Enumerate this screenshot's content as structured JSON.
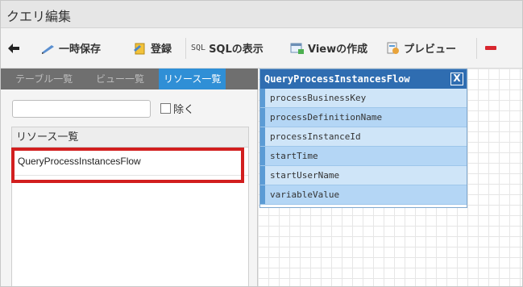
{
  "window": {
    "title": "クエリ編集"
  },
  "toolbar": {
    "back_icon": "arrow-left-icon",
    "temp_save_label": "一時保存",
    "temp_save_icon": "pencil-icon",
    "register_label": "登録",
    "register_icon": "register-icon",
    "sql_tag": "SQL",
    "sql_label": "SQLの表示",
    "view_label": "Viewの作成",
    "view_icon": "create-view-icon",
    "preview_label": "プレビュー",
    "preview_icon": "preview-icon",
    "remove_icon": "minus-icon"
  },
  "tabs": [
    {
      "label": "テーブル一覧"
    },
    {
      "label": "ビュー一覧"
    },
    {
      "label": "リソース一覧",
      "active": true
    }
  ],
  "filter": {
    "value": "",
    "exclude_label": "除く"
  },
  "resource_list": {
    "header": "リソース一覧",
    "items": [
      "QueryProcessInstancesFlow"
    ]
  },
  "table_card": {
    "title": "QueryProcessInstancesFlow",
    "close_label": "X",
    "columns": [
      "processBusinessKey",
      "processDefinitionName",
      "processInstanceId",
      "startTime",
      "startUserName",
      "variableValue"
    ]
  },
  "colors": {
    "accent": "#2f8fd6",
    "card_header": "#2f6db1",
    "highlight": "#d21f1f"
  }
}
